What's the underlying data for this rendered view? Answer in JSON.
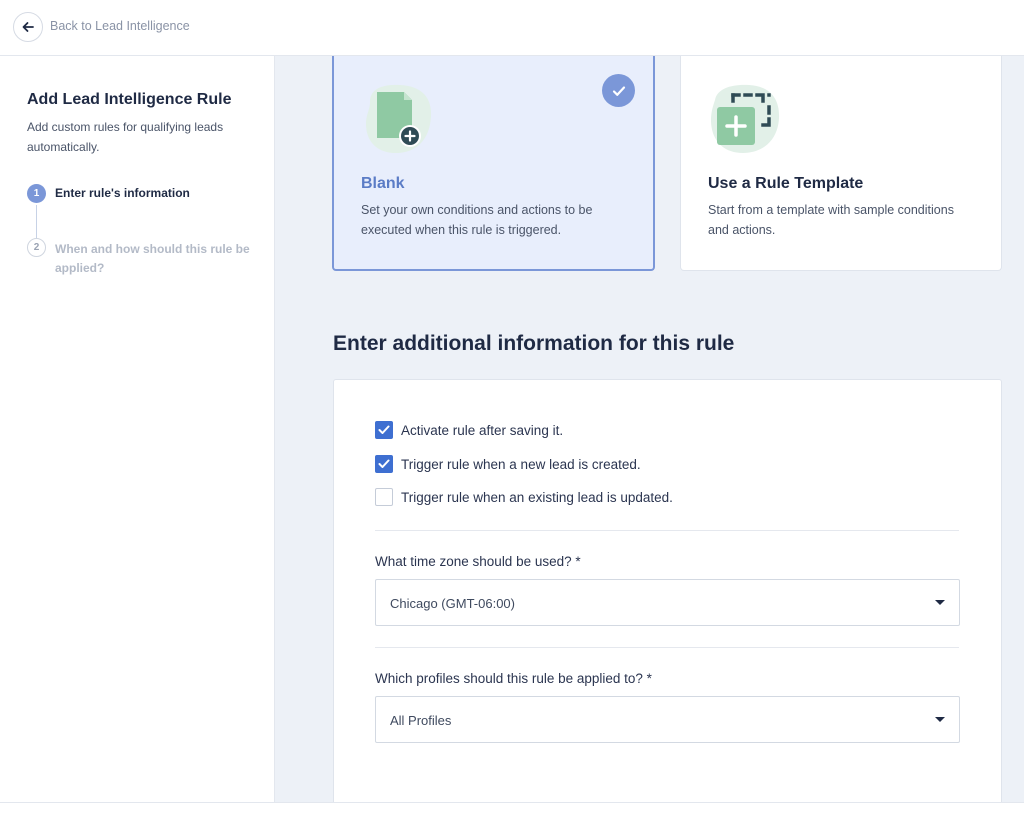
{
  "header": {
    "back_label": "Back to Lead Intelligence"
  },
  "sidebar": {
    "title": "Add Lead Intelligence Rule",
    "description": "Add custom rules for qualifying leads automatically.",
    "steps": [
      {
        "number": "1",
        "label": "Enter rule's information",
        "state": "active"
      },
      {
        "number": "2",
        "label": "When and how should this rule be applied?",
        "state": "inactive"
      }
    ]
  },
  "cards": {
    "blank": {
      "title": "Blank",
      "description": "Set your own conditions and actions to be executed when this rule is triggered.",
      "selected": true,
      "icon": "document-plus-icon"
    },
    "template": {
      "title": "Use a Rule Template",
      "description": "Start from a template with sample conditions and actions.",
      "selected": false,
      "icon": "template-plus-icon"
    }
  },
  "form": {
    "section_title": "Enter additional information for this rule",
    "checkboxes": [
      {
        "label": "Activate rule after saving it.",
        "checked": true
      },
      {
        "label": "Trigger rule when a new lead is created.",
        "checked": true
      },
      {
        "label": "Trigger rule when an existing lead is updated.",
        "checked": false
      }
    ],
    "timezone": {
      "label": "What time zone should be used? *",
      "value": "Chicago (GMT-06:00)"
    },
    "profiles": {
      "label": "Which profiles should this rule be applied to? *",
      "value": "All Profiles"
    }
  },
  "colors": {
    "accent": "#7b97d8",
    "checkbox": "#3e6fd1",
    "icon_green": "#8fc9a3",
    "icon_dark": "#2f4b55",
    "background": "#edf1f7"
  }
}
